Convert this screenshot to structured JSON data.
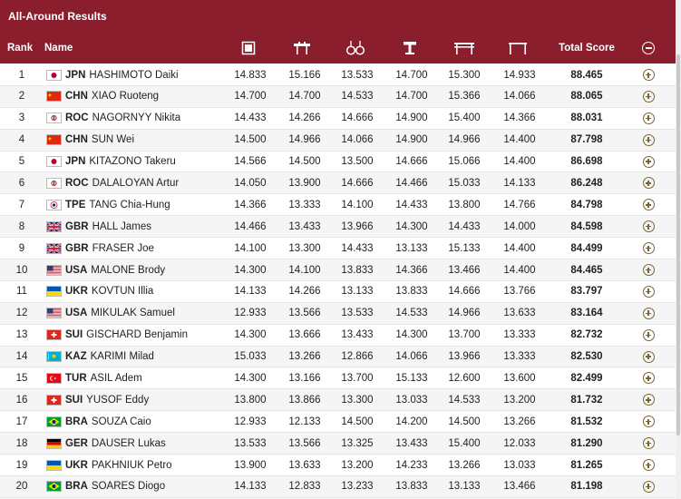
{
  "title": "All-Around Results",
  "header": {
    "rank": "Rank",
    "name": "Name",
    "apparatus_icons": [
      "floor-exercise-icon",
      "pommel-horse-icon",
      "rings-icon",
      "vault-icon",
      "parallel-bars-icon",
      "horizontal-bar-icon"
    ],
    "total": "Total Score"
  },
  "colors": {
    "header_bg": "#8b1e2d",
    "row_alt": "#f5f5f5",
    "plus": "#7a6430"
  },
  "rows": [
    {
      "rank": "1",
      "noc": "JPN",
      "name": "HASHIMOTO Daiki",
      "flag": "jpn",
      "scores": [
        "14.833",
        "15.166",
        "13.533",
        "14.700",
        "15.300",
        "14.933"
      ],
      "total": "88.465"
    },
    {
      "rank": "2",
      "noc": "CHN",
      "name": "XIAO Ruoteng",
      "flag": "chn",
      "scores": [
        "14.700",
        "14.700",
        "14.533",
        "14.700",
        "15.366",
        "14.066"
      ],
      "total": "88.065"
    },
    {
      "rank": "3",
      "noc": "ROC",
      "name": "NAGORNYY Nikita",
      "flag": "roc",
      "scores": [
        "14.433",
        "14.266",
        "14.666",
        "14.900",
        "15.400",
        "14.366"
      ],
      "total": "88.031"
    },
    {
      "rank": "4",
      "noc": "CHN",
      "name": "SUN Wei",
      "flag": "chn",
      "scores": [
        "14.500",
        "14.966",
        "14.066",
        "14.900",
        "14.966",
        "14.400"
      ],
      "total": "87.798"
    },
    {
      "rank": "5",
      "noc": "JPN",
      "name": "KITAZONO Takeru",
      "flag": "jpn",
      "scores": [
        "14.566",
        "14.500",
        "13.500",
        "14.666",
        "15.066",
        "14.400"
      ],
      "total": "86.698"
    },
    {
      "rank": "6",
      "noc": "ROC",
      "name": "DALALOYAN Artur",
      "flag": "roc",
      "scores": [
        "14.050",
        "13.900",
        "14.666",
        "14.466",
        "15.033",
        "14.133"
      ],
      "total": "86.248"
    },
    {
      "rank": "7",
      "noc": "TPE",
      "name": "TANG Chia-Hung",
      "flag": "tpe",
      "scores": [
        "14.366",
        "13.333",
        "14.100",
        "14.433",
        "13.800",
        "14.766"
      ],
      "total": "84.798"
    },
    {
      "rank": "8",
      "noc": "GBR",
      "name": "HALL James",
      "flag": "gbr",
      "scores": [
        "14.466",
        "13.433",
        "13.966",
        "14.300",
        "14.433",
        "14.000"
      ],
      "total": "84.598"
    },
    {
      "rank": "9",
      "noc": "GBR",
      "name": "FRASER Joe",
      "flag": "gbr",
      "scores": [
        "14.100",
        "13.300",
        "14.433",
        "13.133",
        "15.133",
        "14.400"
      ],
      "total": "84.499"
    },
    {
      "rank": "10",
      "noc": "USA",
      "name": "MALONE Brody",
      "flag": "usa",
      "scores": [
        "14.300",
        "14.100",
        "13.833",
        "14.366",
        "13.466",
        "14.400"
      ],
      "total": "84.465"
    },
    {
      "rank": "11",
      "noc": "UKR",
      "name": "KOVTUN Illia",
      "flag": "ukr",
      "scores": [
        "14.133",
        "14.266",
        "13.133",
        "13.833",
        "14.666",
        "13.766"
      ],
      "total": "83.797"
    },
    {
      "rank": "12",
      "noc": "USA",
      "name": "MIKULAK Samuel",
      "flag": "usa",
      "scores": [
        "12.933",
        "13.566",
        "13.533",
        "14.533",
        "14.966",
        "13.633"
      ],
      "total": "83.164"
    },
    {
      "rank": "13",
      "noc": "SUI",
      "name": "GISCHARD Benjamin",
      "flag": "sui",
      "scores": [
        "14.300",
        "13.666",
        "13.433",
        "14.300",
        "13.700",
        "13.333"
      ],
      "total": "82.732"
    },
    {
      "rank": "14",
      "noc": "KAZ",
      "name": "KARIMI Milad",
      "flag": "kaz",
      "scores": [
        "15.033",
        "13.266",
        "12.866",
        "14.066",
        "13.966",
        "13.333"
      ],
      "total": "82.530"
    },
    {
      "rank": "15",
      "noc": "TUR",
      "name": "ASIL Adem",
      "flag": "tur",
      "scores": [
        "14.300",
        "13.166",
        "13.700",
        "15.133",
        "12.600",
        "13.600"
      ],
      "total": "82.499"
    },
    {
      "rank": "16",
      "noc": "SUI",
      "name": "YUSOF Eddy",
      "flag": "sui",
      "scores": [
        "13.800",
        "13.866",
        "13.300",
        "13.033",
        "14.533",
        "13.200"
      ],
      "total": "81.732"
    },
    {
      "rank": "17",
      "noc": "BRA",
      "name": "SOUZA Caio",
      "flag": "bra",
      "scores": [
        "12.933",
        "12.133",
        "14.500",
        "14.200",
        "14.500",
        "13.266"
      ],
      "total": "81.532"
    },
    {
      "rank": "18",
      "noc": "GER",
      "name": "DAUSER Lukas",
      "flag": "ger",
      "scores": [
        "13.533",
        "13.566",
        "13.325",
        "13.433",
        "15.400",
        "12.033"
      ],
      "total": "81.290"
    },
    {
      "rank": "19",
      "noc": "UKR",
      "name": "PAKHNIUK Petro",
      "flag": "ukr",
      "scores": [
        "13.900",
        "13.633",
        "13.200",
        "14.233",
        "13.266",
        "13.033"
      ],
      "total": "81.265"
    },
    {
      "rank": "20",
      "noc": "BRA",
      "name": "SOARES Diogo",
      "flag": "bra",
      "scores": [
        "14.133",
        "12.833",
        "13.233",
        "13.833",
        "13.133",
        "13.466"
      ],
      "total": "81.198"
    }
  ]
}
